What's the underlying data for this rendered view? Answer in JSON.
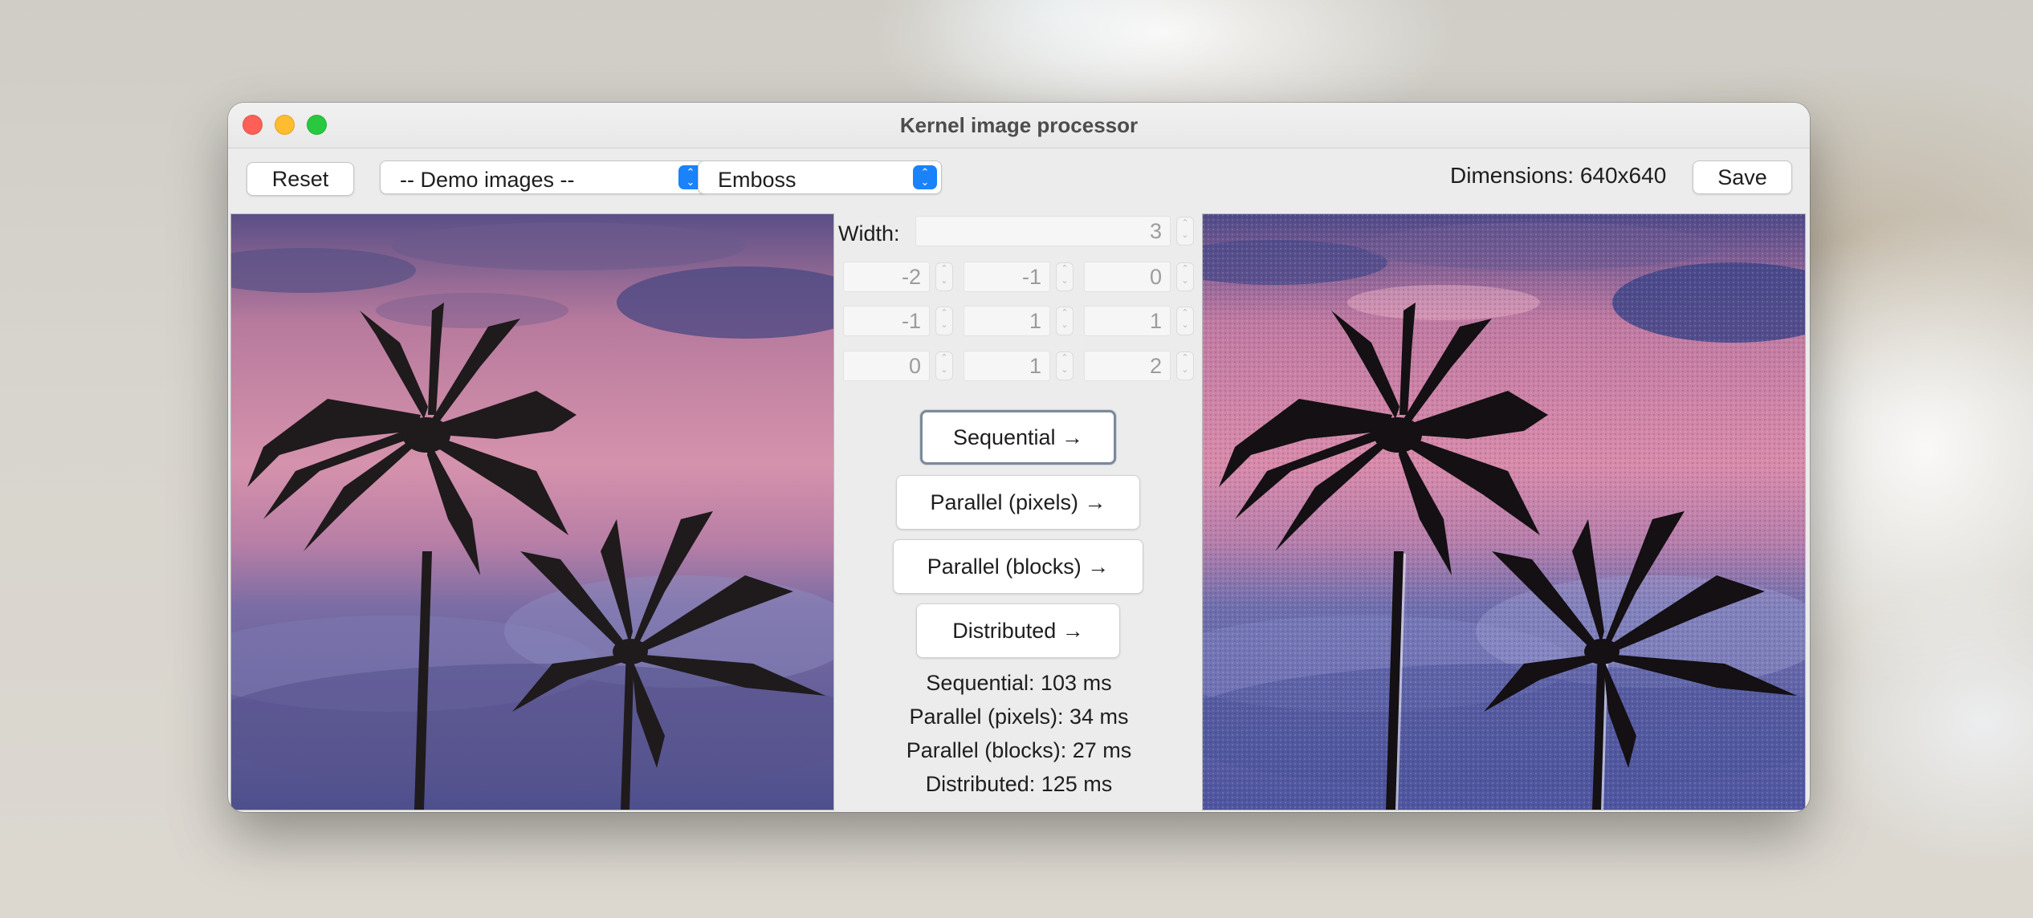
{
  "window": {
    "title": "Kernel image processor"
  },
  "toolbar": {
    "reset_label": "Reset",
    "demo_select_value": "-- Demo images --",
    "filter_select_value": "Emboss",
    "dimensions_text": "Dimensions: 640x640",
    "save_label": "Save"
  },
  "kernel": {
    "width_label": "Width:",
    "width_value": "3",
    "rows": [
      [
        "-2",
        "-1",
        "0"
      ],
      [
        "-1",
        "1",
        "1"
      ],
      [
        "0",
        "1",
        "2"
      ]
    ]
  },
  "actions": {
    "sequential": "Sequential →",
    "parallel_pixels": "Parallel (pixels) →",
    "parallel_blocks": "Parallel (blocks) →",
    "distributed": "Distributed →"
  },
  "timings": {
    "sequential": "Sequential: 103 ms",
    "parallel_pixels": "Parallel (pixels): 34 ms",
    "parallel_blocks": "Parallel (blocks): 27 ms",
    "distributed": "Distributed: 125 ms"
  },
  "images": {
    "source_icon": "palm-trees-sunset-image",
    "result_icon": "palm-trees-sunset-embossed-image"
  },
  "colors": {
    "accent": "#1a82fb",
    "close": "#ff5f57",
    "minimize": "#febc2e",
    "maximize": "#28c840"
  }
}
